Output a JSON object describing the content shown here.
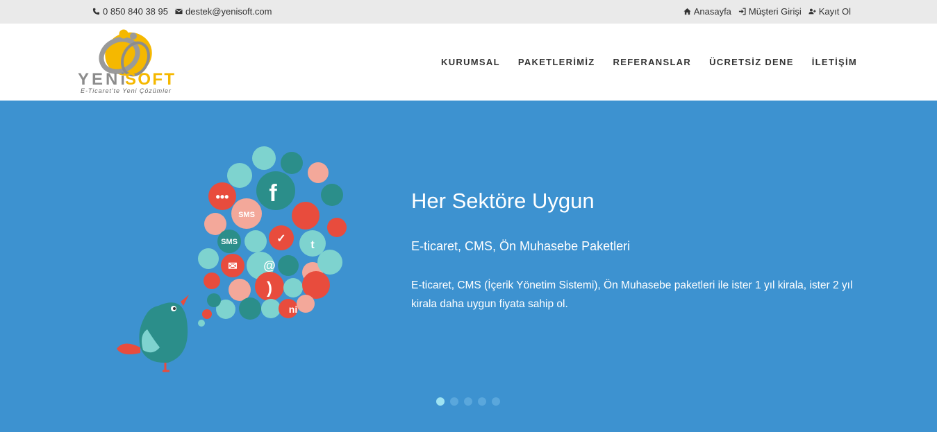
{
  "topbar": {
    "phone": "0 850 840 38 95",
    "email": "destek@yenisoft.com",
    "links": [
      "Anasayfa",
      "Müşteri Girişi",
      "Kayıt Ol"
    ]
  },
  "logo": {
    "name": "YENiSOFT",
    "tagline": "E-Ticaret'te Yeni Çözümler"
  },
  "nav": [
    "KURUMSAL",
    "PAKETLERİMİZ",
    "REFERANSLAR",
    "ÜCRETSİZ DENE",
    "İLETİŞİM"
  ],
  "hero": {
    "title": "Her Sektöre Uygun",
    "subtitle": "E-ticaret, CMS, Ön Muhasebe Paketleri",
    "description": "E-ticaret, CMS (İçerik Yönetim Sistemi), Ön Muhasebe paketleri ile ister 1 yıl kirala, ister 2 yıl kirala daha uygun fiyata sahip ol."
  },
  "slider": {
    "count": 5,
    "active": 1
  },
  "colors": {
    "hero_bg": "#3d92d0",
    "topbar_bg": "#eaeaea",
    "logo_yellow": "#f5b800"
  }
}
